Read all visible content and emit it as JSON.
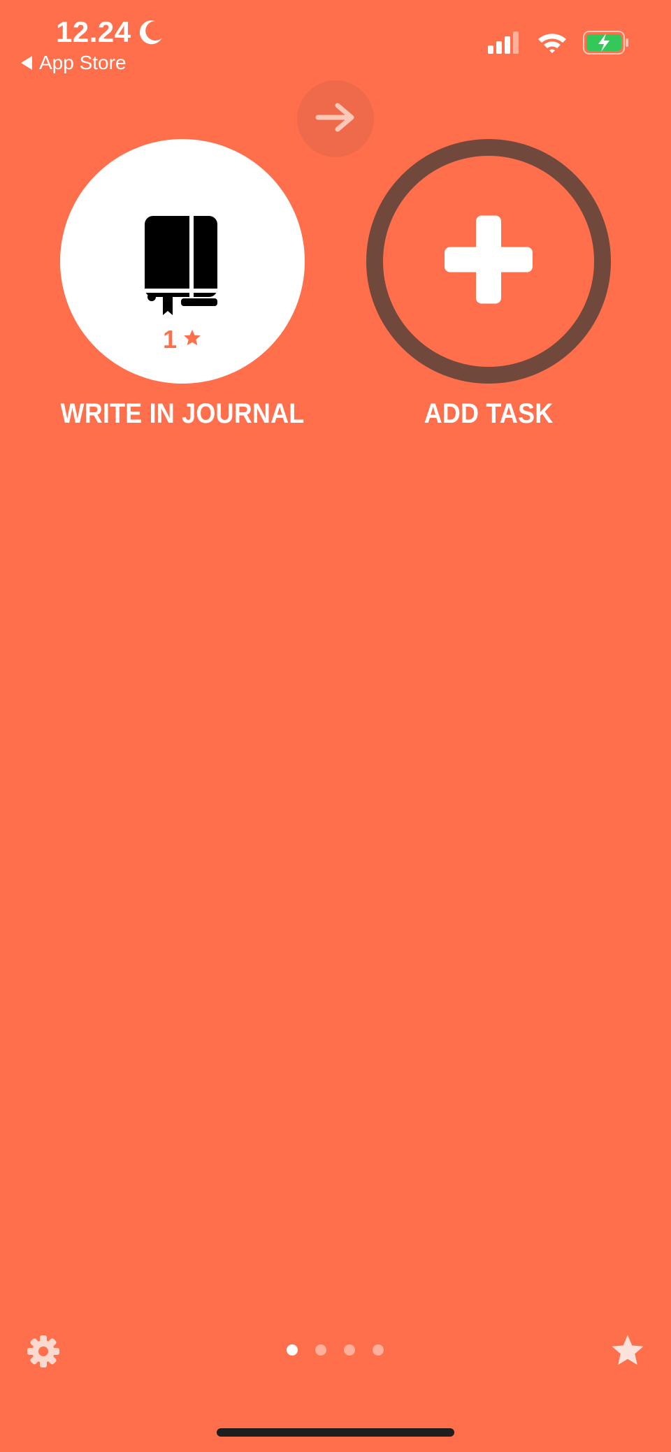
{
  "status_bar": {
    "time": "12.24",
    "back_app": "App Store"
  },
  "journal": {
    "label": "WRITE IN JOURNAL",
    "count": "1"
  },
  "add_task": {
    "label": "ADD TASK"
  },
  "pager": {
    "pages": 4,
    "active_index": 0
  },
  "colors": {
    "background": "#FF6F4B",
    "ring": "#70483C",
    "battery_fill": "#34C759"
  },
  "icons": {
    "moon": "moon-icon",
    "signal": "cellular-signal-icon",
    "wifi": "wifi-icon",
    "battery": "battery-charging-icon",
    "arrow": "arrow-right-icon",
    "journal": "book-icon",
    "star": "star-icon",
    "plus": "plus-icon",
    "gear": "gear-icon"
  }
}
